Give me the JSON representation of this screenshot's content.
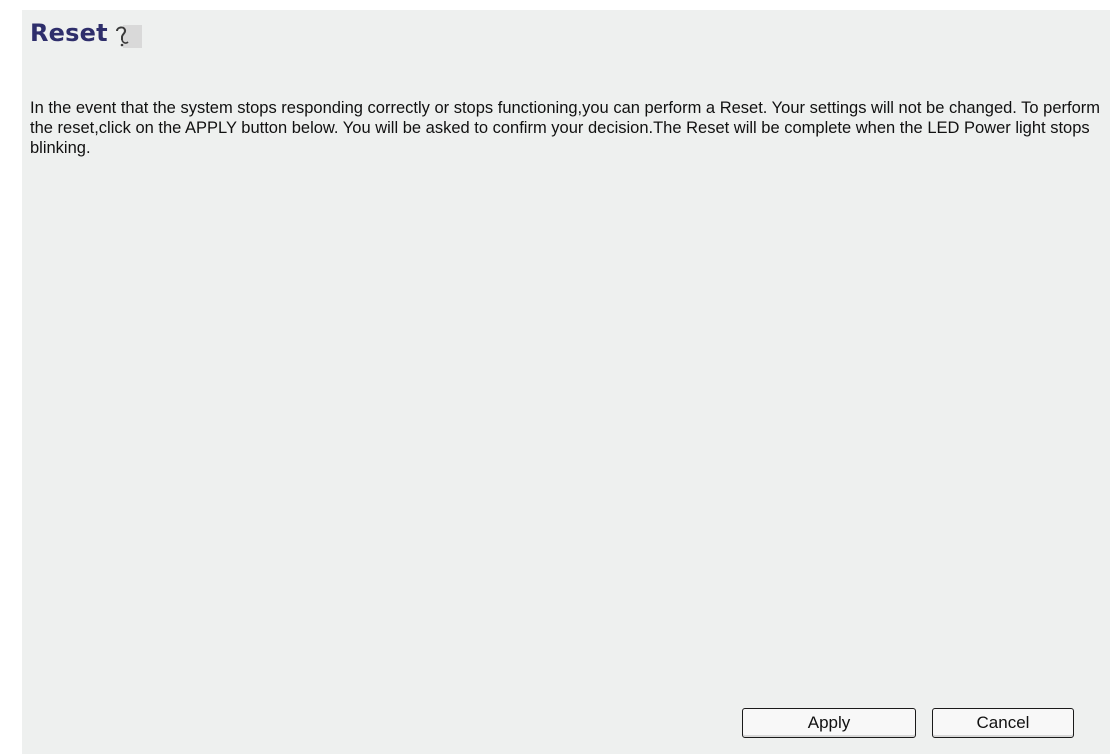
{
  "page": {
    "title": "Reset",
    "help_icon": "help-icon",
    "description": "In the event that the system stops responding correctly or stops functioning,you can perform a Reset. Your settings will not be changed. To perform the reset,click on the APPLY button below. You will be asked to confirm your decision.The Reset will be complete when the LED Power light stops blinking."
  },
  "buttons": {
    "apply_label": "Apply",
    "cancel_label": "Cancel"
  },
  "colors": {
    "title": "#2e2e6b",
    "panel_background": "#eef0ef"
  }
}
